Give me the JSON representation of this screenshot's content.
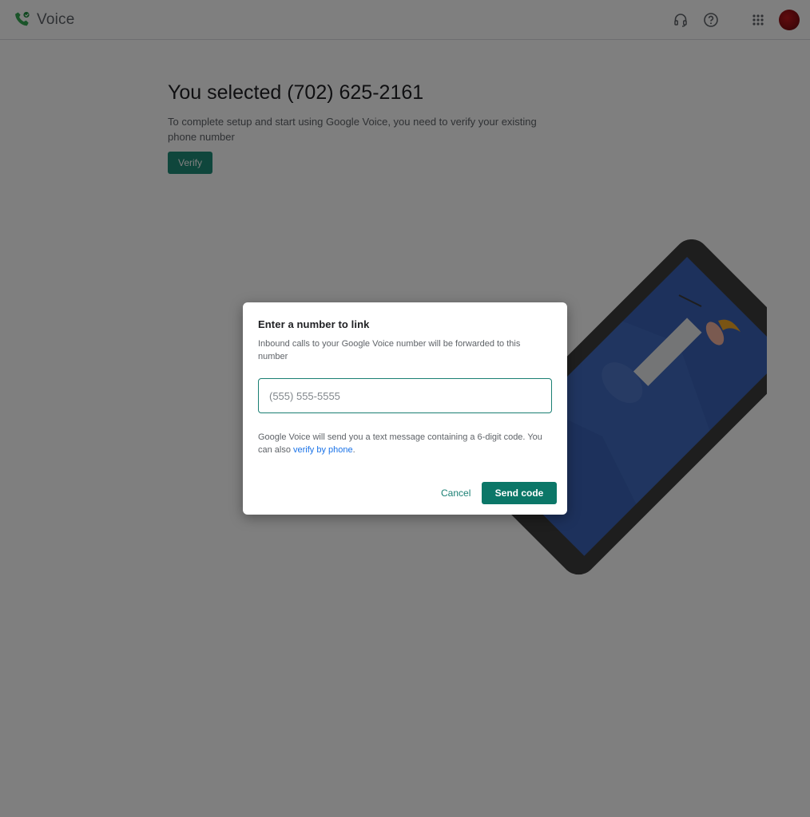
{
  "app": {
    "name": "Voice",
    "brand_colors": {
      "green": "#34a853",
      "teal": "#0b7768"
    }
  },
  "topbar": {
    "icons": [
      "headset-icon",
      "help-icon",
      "apps-grid-icon"
    ],
    "avatar": "account-avatar"
  },
  "main": {
    "title": "You selected (702) 625-2161",
    "description": "To complete setup and start using Google Voice, you need to verify your existing phone number",
    "verify_label": "Verify"
  },
  "dialog": {
    "title": "Enter a number to link",
    "subtitle": "Inbound calls to your Google Voice number will be forwarded to this number",
    "input_placeholder": "(555) 555-5555",
    "input_value": "",
    "info_prefix": "Google Voice will send you a text message containing a 6-digit code. You can also ",
    "info_link": "verify by phone",
    "info_suffix": ".",
    "cancel_label": "Cancel",
    "send_label": "Send code"
  }
}
